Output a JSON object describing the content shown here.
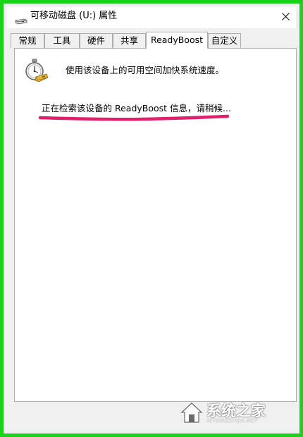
{
  "window": {
    "title": "可移动磁盘 (U:) 属性",
    "title_icon": "usb-drive-icon",
    "close_glyph": "✕"
  },
  "tabs": [
    {
      "label": "常规",
      "active": false
    },
    {
      "label": "工具",
      "active": false
    },
    {
      "label": "硬件",
      "active": false
    },
    {
      "label": "共享",
      "active": false
    },
    {
      "label": "ReadyBoost",
      "active": true
    },
    {
      "label": "自定义",
      "active": false
    }
  ],
  "readyboost": {
    "icon": "stopwatch-icon",
    "description": "使用该设备上的可用空间加快系统速度。",
    "status": "正在检索该设备的 ReadyBoost 信息，请稍候..."
  },
  "annotation": {
    "underline_color": "#e0206a"
  },
  "watermark": {
    "name": "系统之家",
    "domain": "XITONGZHIJIA.NET"
  }
}
